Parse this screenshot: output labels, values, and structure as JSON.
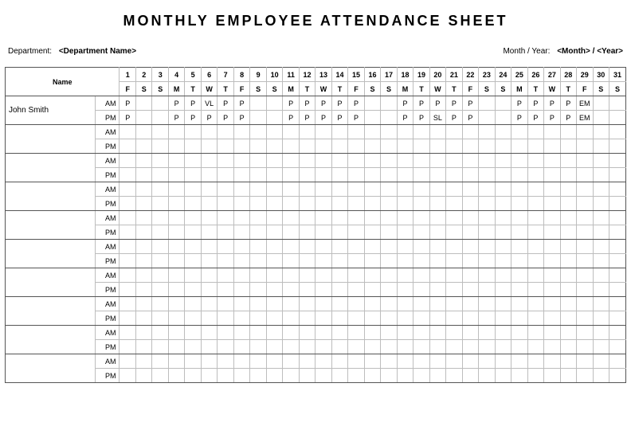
{
  "title": "MONTHLY EMPLOYEE ATTENDANCE SHEET",
  "meta": {
    "department_label": "Department:",
    "department_value": "<Department Name>",
    "month_year_label": "Month / Year:",
    "month_year_value": "<Month> / <Year>"
  },
  "headers": {
    "name": "Name",
    "days": [
      "1",
      "2",
      "3",
      "4",
      "5",
      "6",
      "7",
      "8",
      "9",
      "10",
      "11",
      "12",
      "13",
      "14",
      "15",
      "16",
      "17",
      "18",
      "19",
      "20",
      "21",
      "22",
      "23",
      "24",
      "25",
      "26",
      "27",
      "28",
      "29",
      "30",
      "31"
    ],
    "weekdays": [
      "F",
      "S",
      "S",
      "M",
      "T",
      "W",
      "T",
      "F",
      "S",
      "S",
      "M",
      "T",
      "W",
      "T",
      "F",
      "S",
      "S",
      "M",
      "T",
      "W",
      "T",
      "F",
      "S",
      "S",
      "M",
      "T",
      "W",
      "T",
      "F",
      "S",
      "S"
    ]
  },
  "periods": {
    "am": "AM",
    "pm": "PM"
  },
  "employees": [
    {
      "name": "John Smith",
      "am": [
        "P",
        "",
        "",
        "P",
        "P",
        "VL",
        "P",
        "P",
        "",
        "",
        "P",
        "P",
        "P",
        "P",
        "P",
        "",
        "",
        "P",
        "P",
        "P",
        "P",
        "P",
        "",
        "",
        "P",
        "P",
        "P",
        "P",
        "EM",
        "",
        ""
      ],
      "pm": [
        "P",
        "",
        "",
        "P",
        "P",
        "P",
        "P",
        "P",
        "",
        "",
        "P",
        "P",
        "P",
        "P",
        "P",
        "",
        "",
        "P",
        "P",
        "SL",
        "P",
        "P",
        "",
        "",
        "P",
        "P",
        "P",
        "P",
        "EM",
        "",
        ""
      ]
    },
    {
      "name": "",
      "am": [],
      "pm": []
    },
    {
      "name": "",
      "am": [],
      "pm": []
    },
    {
      "name": "",
      "am": [],
      "pm": []
    },
    {
      "name": "",
      "am": [],
      "pm": []
    },
    {
      "name": "",
      "am": [],
      "pm": []
    },
    {
      "name": "",
      "am": [],
      "pm": []
    },
    {
      "name": "",
      "am": [],
      "pm": []
    },
    {
      "name": "",
      "am": [],
      "pm": []
    },
    {
      "name": "",
      "am": [],
      "pm": []
    }
  ]
}
